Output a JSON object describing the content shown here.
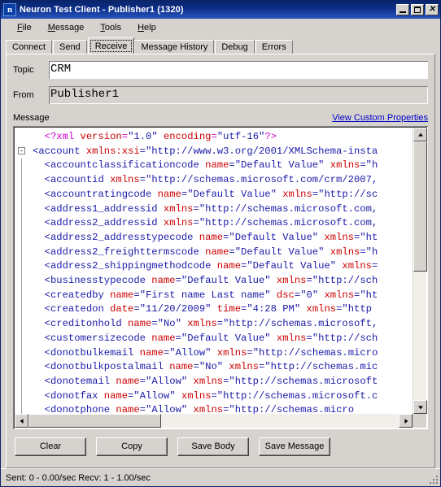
{
  "window": {
    "title": "Neuron Test Client - Publisher1 (1320)",
    "icon": "neuron-app-icon",
    "icon_glyph": "n",
    "minimize_label": "Minimize",
    "maximize_label": "Maximize",
    "close_label": "Close",
    "close_glyph": "✕"
  },
  "menubar": {
    "items": [
      {
        "label": "File",
        "accel": "F"
      },
      {
        "label": "Message",
        "accel": "M"
      },
      {
        "label": "Tools",
        "accel": "T"
      },
      {
        "label": "Help",
        "accel": "H"
      }
    ]
  },
  "tabs": {
    "selected": "Receive",
    "items": [
      {
        "label": "Connect"
      },
      {
        "label": "Send"
      },
      {
        "label": "Receive"
      },
      {
        "label": "Message History"
      },
      {
        "label": "Debug"
      },
      {
        "label": "Errors"
      }
    ]
  },
  "form": {
    "topic_label": "Topic",
    "topic_value": "CRM",
    "topic_placeholder": "",
    "from_label": "From",
    "from_value": "Publisher1",
    "from_placeholder": ""
  },
  "message": {
    "label": "Message",
    "custom_properties_link": "View Custom Properties"
  },
  "xml": {
    "lines": [
      {
        "indent": 2,
        "gutter": "",
        "tokens": [
          {
            "t": "dec",
            "s": "<?"
          },
          {
            "t": "dec",
            "s": "xml"
          },
          {
            "t": "at",
            "s": " version"
          },
          {
            "t": "dec",
            "s": "="
          },
          {
            "t": "vl",
            "s": "\"1.0\""
          },
          {
            "t": "at",
            "s": " encoding"
          },
          {
            "t": "dec",
            "s": "="
          },
          {
            "t": "vl",
            "s": "\"utf-16\""
          },
          {
            "t": "dec",
            "s": "?>"
          }
        ]
      },
      {
        "indent": 0,
        "gutter": "-",
        "tokens": [
          {
            "t": "tg",
            "s": "<account "
          },
          {
            "t": "at",
            "s": "xmlns:xsi"
          },
          {
            "t": "tg",
            "s": "="
          },
          {
            "t": "vl",
            "s": "\"http://www.w3.org/2001/XMLSchema-insta"
          }
        ]
      },
      {
        "indent": 2,
        "gutter": "",
        "tokens": [
          {
            "t": "tg",
            "s": "<accountclassificationcode "
          },
          {
            "t": "at",
            "s": "name"
          },
          {
            "t": "tg",
            "s": "="
          },
          {
            "t": "vl",
            "s": "\"Default Value\" "
          },
          {
            "t": "at",
            "s": "xmlns"
          },
          {
            "t": "tg",
            "s": "="
          },
          {
            "t": "vl",
            "s": "\"h"
          }
        ]
      },
      {
        "indent": 2,
        "gutter": "",
        "tokens": [
          {
            "t": "tg",
            "s": "<accountid "
          },
          {
            "t": "at",
            "s": "xmlns"
          },
          {
            "t": "tg",
            "s": "="
          },
          {
            "t": "vl",
            "s": "\"http://schemas.microsoft.com/crm/2007,"
          }
        ]
      },
      {
        "indent": 2,
        "gutter": "",
        "tokens": [
          {
            "t": "tg",
            "s": "<accountratingcode "
          },
          {
            "t": "at",
            "s": "name"
          },
          {
            "t": "tg",
            "s": "="
          },
          {
            "t": "vl",
            "s": "\"Default Value\" "
          },
          {
            "t": "at",
            "s": "xmlns"
          },
          {
            "t": "tg",
            "s": "="
          },
          {
            "t": "vl",
            "s": "\"http://sc"
          }
        ]
      },
      {
        "indent": 2,
        "gutter": "",
        "tokens": [
          {
            "t": "tg",
            "s": "<address1_addressid "
          },
          {
            "t": "at",
            "s": "xmlns"
          },
          {
            "t": "tg",
            "s": "="
          },
          {
            "t": "vl",
            "s": "\"http://schemas.microsoft.com,"
          }
        ]
      },
      {
        "indent": 2,
        "gutter": "",
        "tokens": [
          {
            "t": "tg",
            "s": "<address2_addressid "
          },
          {
            "t": "at",
            "s": "xmlns"
          },
          {
            "t": "tg",
            "s": "="
          },
          {
            "t": "vl",
            "s": "\"http://schemas.microsoft.com,"
          }
        ]
      },
      {
        "indent": 2,
        "gutter": "",
        "tokens": [
          {
            "t": "tg",
            "s": "<address2_addresstypecode "
          },
          {
            "t": "at",
            "s": "name"
          },
          {
            "t": "tg",
            "s": "="
          },
          {
            "t": "vl",
            "s": "\"Default Value\" "
          },
          {
            "t": "at",
            "s": "xmlns"
          },
          {
            "t": "tg",
            "s": "="
          },
          {
            "t": "vl",
            "s": "\"ht"
          }
        ]
      },
      {
        "indent": 2,
        "gutter": "",
        "tokens": [
          {
            "t": "tg",
            "s": "<address2_freighttermscode "
          },
          {
            "t": "at",
            "s": "name"
          },
          {
            "t": "tg",
            "s": "="
          },
          {
            "t": "vl",
            "s": "\"Default Value\" "
          },
          {
            "t": "at",
            "s": "xmlns"
          },
          {
            "t": "tg",
            "s": "="
          },
          {
            "t": "vl",
            "s": "\"h"
          }
        ]
      },
      {
        "indent": 2,
        "gutter": "",
        "tokens": [
          {
            "t": "tg",
            "s": "<address2_shippingmethodcode "
          },
          {
            "t": "at",
            "s": "name"
          },
          {
            "t": "tg",
            "s": "="
          },
          {
            "t": "vl",
            "s": "\"Default Value\" "
          },
          {
            "t": "at",
            "s": "xmlns"
          },
          {
            "t": "tg",
            "s": "="
          }
        ]
      },
      {
        "indent": 2,
        "gutter": "",
        "tokens": [
          {
            "t": "tg",
            "s": "<businesstypecode "
          },
          {
            "t": "at",
            "s": "name"
          },
          {
            "t": "tg",
            "s": "="
          },
          {
            "t": "vl",
            "s": "\"Default Value\" "
          },
          {
            "t": "at",
            "s": "xmlns"
          },
          {
            "t": "tg",
            "s": "="
          },
          {
            "t": "vl",
            "s": "\"http://sch"
          }
        ]
      },
      {
        "indent": 2,
        "gutter": "",
        "tokens": [
          {
            "t": "tg",
            "s": "<createdby "
          },
          {
            "t": "at",
            "s": "name"
          },
          {
            "t": "tg",
            "s": "="
          },
          {
            "t": "vl",
            "s": "\"First name Last name\" "
          },
          {
            "t": "at",
            "s": "dsc"
          },
          {
            "t": "tg",
            "s": "="
          },
          {
            "t": "vl",
            "s": "\"0\" "
          },
          {
            "t": "at",
            "s": "xmlns"
          },
          {
            "t": "tg",
            "s": "="
          },
          {
            "t": "vl",
            "s": "\"ht"
          }
        ]
      },
      {
        "indent": 2,
        "gutter": "",
        "tokens": [
          {
            "t": "tg",
            "s": "<createdon "
          },
          {
            "t": "at",
            "s": "date"
          },
          {
            "t": "tg",
            "s": "="
          },
          {
            "t": "vl",
            "s": "\"11/20/2009\" "
          },
          {
            "t": "at",
            "s": "time"
          },
          {
            "t": "tg",
            "s": "="
          },
          {
            "t": "vl",
            "s": "\"4:28 PM\" "
          },
          {
            "t": "at",
            "s": "xmlns"
          },
          {
            "t": "tg",
            "s": "="
          },
          {
            "t": "vl",
            "s": "\"http"
          }
        ]
      },
      {
        "indent": 2,
        "gutter": "",
        "tokens": [
          {
            "t": "tg",
            "s": "<creditonhold "
          },
          {
            "t": "at",
            "s": "name"
          },
          {
            "t": "tg",
            "s": "="
          },
          {
            "t": "vl",
            "s": "\"No\" "
          },
          {
            "t": "at",
            "s": "xmlns"
          },
          {
            "t": "tg",
            "s": "="
          },
          {
            "t": "vl",
            "s": "\"http://schemas.microsoft,"
          }
        ]
      },
      {
        "indent": 2,
        "gutter": "",
        "tokens": [
          {
            "t": "tg",
            "s": "<customersizecode "
          },
          {
            "t": "at",
            "s": "name"
          },
          {
            "t": "tg",
            "s": "="
          },
          {
            "t": "vl",
            "s": "\"Default Value\" "
          },
          {
            "t": "at",
            "s": "xmlns"
          },
          {
            "t": "tg",
            "s": "="
          },
          {
            "t": "vl",
            "s": "\"http://sch"
          }
        ]
      },
      {
        "indent": 2,
        "gutter": "",
        "tokens": [
          {
            "t": "tg",
            "s": "<donotbulkemail "
          },
          {
            "t": "at",
            "s": "name"
          },
          {
            "t": "tg",
            "s": "="
          },
          {
            "t": "vl",
            "s": "\"Allow\" "
          },
          {
            "t": "at",
            "s": "xmlns"
          },
          {
            "t": "tg",
            "s": "="
          },
          {
            "t": "vl",
            "s": "\"http://schemas.micro"
          }
        ]
      },
      {
        "indent": 2,
        "gutter": "",
        "tokens": [
          {
            "t": "tg",
            "s": "<donotbulkpostalmail "
          },
          {
            "t": "at",
            "s": "name"
          },
          {
            "t": "tg",
            "s": "="
          },
          {
            "t": "vl",
            "s": "\"No\" "
          },
          {
            "t": "at",
            "s": "xmlns"
          },
          {
            "t": "tg",
            "s": "="
          },
          {
            "t": "vl",
            "s": "\"http://schemas.mic"
          }
        ]
      },
      {
        "indent": 2,
        "gutter": "",
        "tokens": [
          {
            "t": "tg",
            "s": "<donotemail "
          },
          {
            "t": "at",
            "s": "name"
          },
          {
            "t": "tg",
            "s": "="
          },
          {
            "t": "vl",
            "s": "\"Allow\" "
          },
          {
            "t": "at",
            "s": "xmlns"
          },
          {
            "t": "tg",
            "s": "="
          },
          {
            "t": "vl",
            "s": "\"http://schemas.microsoft"
          }
        ]
      },
      {
        "indent": 2,
        "gutter": "",
        "tokens": [
          {
            "t": "tg",
            "s": "<donotfax "
          },
          {
            "t": "at",
            "s": "name"
          },
          {
            "t": "tg",
            "s": "="
          },
          {
            "t": "vl",
            "s": "\"Allow\" "
          },
          {
            "t": "at",
            "s": "xmlns"
          },
          {
            "t": "tg",
            "s": "="
          },
          {
            "t": "vl",
            "s": "\"http://schemas.microsoft.c"
          }
        ]
      },
      {
        "indent": 2,
        "gutter": "",
        "tokens": [
          {
            "t": "tg",
            "s": "<donotphone "
          },
          {
            "t": "at",
            "s": "name"
          },
          {
            "t": "tg",
            "s": "="
          },
          {
            "t": "vl",
            "s": "\"Allow\" "
          },
          {
            "t": "at",
            "s": "xmlns"
          },
          {
            "t": "tg",
            "s": "="
          },
          {
            "t": "vl",
            "s": "\"http://schemas.micro"
          }
        ]
      }
    ]
  },
  "actions": {
    "buttons": [
      {
        "label": "Clear"
      },
      {
        "label": "Copy"
      },
      {
        "label": "Save Body"
      },
      {
        "label": "Save Message"
      }
    ]
  },
  "status": {
    "text": "Sent: 0  -  0.00/sec Recv: 1  -  1.00/sec",
    "gripper": "resize-gripper"
  },
  "colors": {
    "titlebar_start": "#0a246a",
    "titlebar_end": "#2a55bb",
    "window_face": "#d6d3ce",
    "link": "#0000cc",
    "xml_tag": "#1a1aa8",
    "xml_attr": "#cc0000",
    "xml_value": "#1a1aa8",
    "xml_decl": "#cc00cc"
  }
}
